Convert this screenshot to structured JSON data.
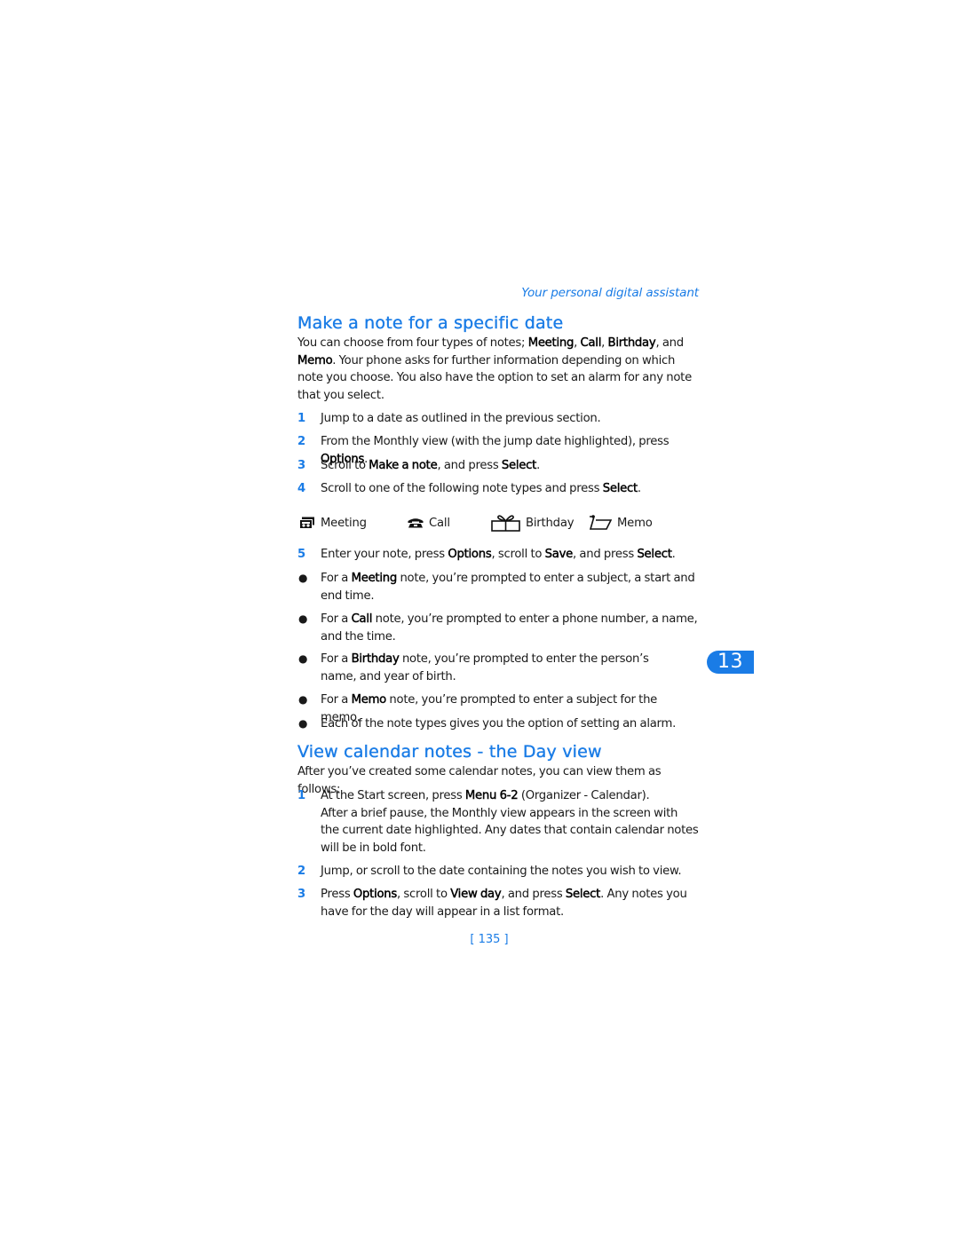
{
  "running_header": "Your personal digital assistant",
  "section1": {
    "title": "Make a note for a specific date",
    "intro": [
      {
        "t": "You can choose from four types of notes; "
      },
      {
        "t": "Meeting",
        "b": true
      },
      {
        "t": ", "
      },
      {
        "t": "Call",
        "b": true
      },
      {
        "t": ", "
      },
      {
        "t": "Birthday",
        "b": true
      },
      {
        "t": ", and "
      },
      {
        "t": "Memo",
        "b": true
      },
      {
        "t": ". Your phone asks for further information depending on which note you choose. You also have the option to set an alarm for any note that you select."
      }
    ],
    "steps": [
      {
        "num": "1",
        "parts": [
          {
            "t": "Jump to a date as outlined in the previous section."
          }
        ]
      },
      {
        "num": "2",
        "parts": [
          {
            "t": "From the Monthly view (with the jump date highlighted), press "
          },
          {
            "t": "Options",
            "b": true
          },
          {
            "t": "."
          }
        ]
      },
      {
        "num": "3",
        "parts": [
          {
            "t": "Scroll to "
          },
          {
            "t": "Make a note",
            "b": true
          },
          {
            "t": ", and press "
          },
          {
            "t": "Select",
            "b": true
          },
          {
            "t": "."
          }
        ]
      },
      {
        "num": "4",
        "parts": [
          {
            "t": "Scroll to one of the following note types and press "
          },
          {
            "t": "Select",
            "b": true
          },
          {
            "t": "."
          }
        ]
      }
    ],
    "note_types": [
      {
        "icon": "meeting-icon",
        "label": "Meeting"
      },
      {
        "icon": "call-icon",
        "label": "Call"
      },
      {
        "icon": "birthday-icon",
        "label": "Birthday"
      },
      {
        "icon": "memo-icon",
        "label": "Memo"
      }
    ],
    "step5": {
      "num": "5",
      "parts": [
        {
          "t": "Enter your note, press "
        },
        {
          "t": "Options",
          "b": true
        },
        {
          "t": ", scroll to "
        },
        {
          "t": "Save",
          "b": true
        },
        {
          "t": ", and press "
        },
        {
          "t": "Select",
          "b": true
        },
        {
          "t": "."
        }
      ]
    },
    "bullets": [
      {
        "parts": [
          {
            "t": "For a "
          },
          {
            "t": "Meeting",
            "b": true
          },
          {
            "t": " note, you’re prompted to enter a subject, a start and end time."
          }
        ]
      },
      {
        "parts": [
          {
            "t": "For a "
          },
          {
            "t": "Call",
            "b": true
          },
          {
            "t": " note, you’re prompted to enter a phone number, a name, and the time."
          }
        ]
      },
      {
        "parts": [
          {
            "t": "For a "
          },
          {
            "t": "Birthday",
            "b": true
          },
          {
            "t": " note, you’re prompted to enter the person’s name, and year of birth."
          }
        ]
      },
      {
        "parts": [
          {
            "t": "For a "
          },
          {
            "t": "Memo",
            "b": true
          },
          {
            "t": " note, you’re prompted to enter a subject for the memo."
          }
        ]
      },
      {
        "parts": [
          {
            "t": "Each of the note types gives you the option of setting an alarm."
          }
        ]
      }
    ]
  },
  "section2": {
    "title": "View calendar notes - the Day view",
    "intro": [
      {
        "t": "After you’ve created some calendar notes, you can view them as follows:"
      }
    ],
    "steps": [
      {
        "num": "1",
        "parts": [
          {
            "t": "At the Start screen, press "
          },
          {
            "t": "Menu 6-2",
            "b": true
          },
          {
            "t": " (Organizer - Calendar)."
          }
        ],
        "followup": "After a brief pause, the Monthly view appears in the screen with the current date highlighted. Any dates that contain calendar notes will be in bold font."
      },
      {
        "num": "2",
        "parts": [
          {
            "t": "Jump, or scroll to the date containing the notes you wish to view."
          }
        ]
      },
      {
        "num": "3",
        "parts": [
          {
            "t": "Press "
          },
          {
            "t": "Options",
            "b": true
          },
          {
            "t": ", scroll to "
          },
          {
            "t": "View day",
            "b": true
          },
          {
            "t": ", and press "
          },
          {
            "t": "Select",
            "b": true
          },
          {
            "t": ". Any notes you have for the day will appear in a list format."
          }
        ]
      }
    ]
  },
  "chapter_tab": "13",
  "page_number": "[ 135 ]",
  "colors": {
    "accent": "#1a7ce6",
    "text": "#1a1a1a"
  }
}
